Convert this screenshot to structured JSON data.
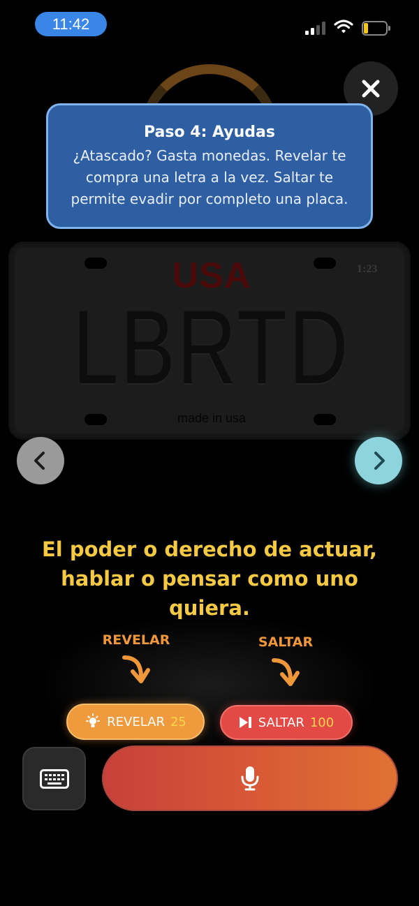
{
  "status_bar": {
    "time": "11:42"
  },
  "tutorial": {
    "title": "Paso 4: Ayudas",
    "body_line1": "¿Atascado? Gasta monedas. Revelar te",
    "body_line2": "compra una letra a la vez. Saltar te",
    "body_line3": "permite evadir por completo una placa."
  },
  "plate": {
    "country": "USA",
    "stamp": "1:23",
    "text": "LBRTD",
    "footer": "made in usa"
  },
  "clue": {
    "line1": "El poder o derecho de actuar,",
    "line2": "hablar o pensar como uno",
    "line3": "quiera."
  },
  "hints": {
    "reveal_label": "REVELAR",
    "skip_label": "SALTAR"
  },
  "actions": {
    "reveal_text": "REVELAR",
    "reveal_cost": "25",
    "skip_text": "SALTAR",
    "skip_cost": "100"
  },
  "icons": {
    "close": "close-icon",
    "prev": "chevron-left-icon",
    "next": "chevron-right-icon",
    "reveal": "lightbulb-icon",
    "skip": "skip-icon",
    "keyboard": "keyboard-icon",
    "mic": "microphone-icon"
  },
  "colors": {
    "tooltip_bg": "#2f5fa3",
    "clue_text": "#f5c942",
    "reveal_btn": "#f09a3e",
    "skip_btn": "#e44a45",
    "next_btn": "#8fd4dd"
  }
}
